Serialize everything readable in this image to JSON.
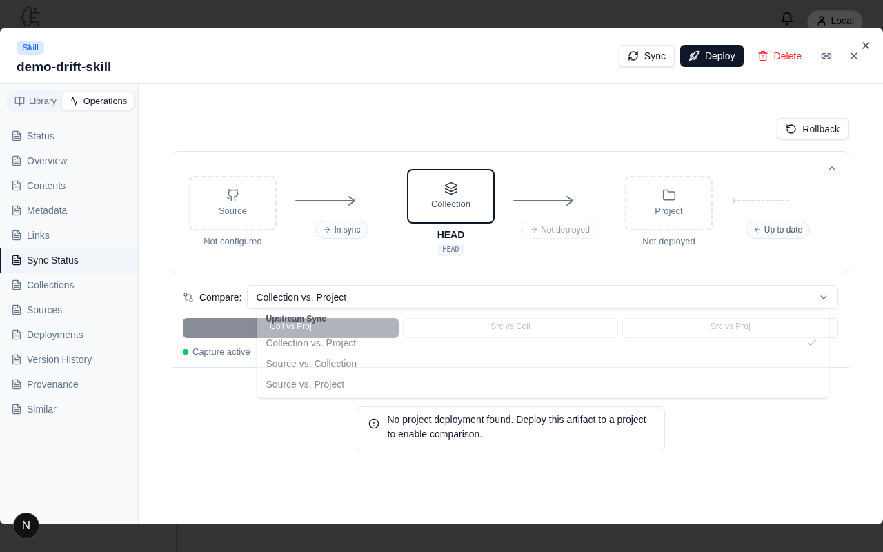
{
  "app_header": {
    "account_button": "Local"
  },
  "dialog": {
    "badge": "Skill",
    "title": "demo-drift-skill",
    "actions": [
      {
        "kind": "sync",
        "label": "Sync"
      },
      {
        "kind": "deploy",
        "label": "Deploy"
      },
      {
        "kind": "delete",
        "label": "Delete"
      }
    ]
  },
  "sidebar": {
    "tabs": [
      {
        "label": "Library",
        "selected": false
      },
      {
        "label": "Operations",
        "selected": true
      }
    ],
    "items": [
      {
        "label": "Status",
        "selected": false
      },
      {
        "label": "Overview",
        "selected": false
      },
      {
        "label": "Contents",
        "selected": false
      },
      {
        "label": "Metadata",
        "selected": false
      },
      {
        "label": "Links",
        "selected": false
      },
      {
        "label": "Sync Status",
        "selected": true
      },
      {
        "label": "Collections",
        "selected": false
      },
      {
        "label": "Sources",
        "selected": false
      },
      {
        "label": "Deployments",
        "selected": false
      },
      {
        "label": "Version History",
        "selected": false
      },
      {
        "label": "Provenance",
        "selected": false
      },
      {
        "label": "Similar",
        "selected": false
      }
    ]
  },
  "rollback_button": "Rollback",
  "pipeline": {
    "nodes": [
      {
        "kind": "source",
        "label": "Source",
        "active": false,
        "caption": "Not configured"
      },
      {
        "kind": "collection",
        "label": "Collection",
        "active": true,
        "caption": "HEAD",
        "tag": "HEAD"
      },
      {
        "kind": "project",
        "label": "Project",
        "active": false,
        "caption": "Not deployed"
      }
    ],
    "links": [
      {
        "label": "In sync",
        "reverse": false,
        "dashed": false,
        "muted": false
      },
      {
        "label": "Not deployed",
        "reverse": false,
        "dashed": false,
        "muted": true
      },
      {
        "label": "Up to date",
        "reverse": true,
        "dashed": true,
        "muted": false
      }
    ]
  },
  "compare": {
    "label": "Compare:",
    "value": "Collection vs. Project",
    "menu": {
      "group": "Upstream Sync",
      "options": [
        {
          "label": "Collection vs. Project",
          "selected": true
        },
        {
          "label": "Source vs. Collection",
          "selected": false
        },
        {
          "label": "Source vs. Project",
          "selected": false
        }
      ]
    },
    "tabs": [
      {
        "label": "Coll vs Proj",
        "selected": true
      },
      {
        "label": "Src vs Coll",
        "selected": false
      },
      {
        "label": "Src vs Proj",
        "selected": false
      }
    ],
    "capture": {
      "label": "Capture active",
      "active": true
    }
  },
  "alert": {
    "text": "No project deployment found. Deploy this artifact to a project to enable comparison."
  },
  "dev_button": "N"
}
